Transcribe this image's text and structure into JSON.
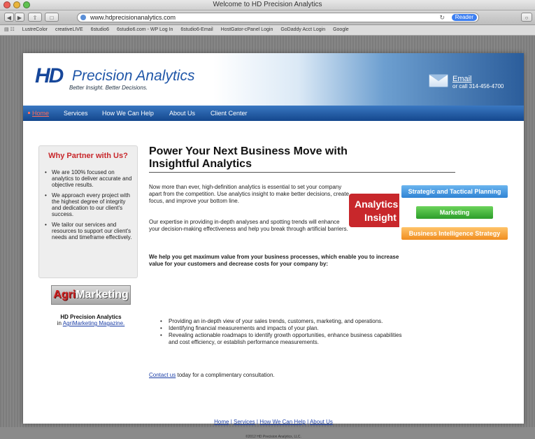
{
  "window": {
    "title": "Welcome to HD Precision Analytics"
  },
  "browser": {
    "url": "www.hdprecisionanalytics.com",
    "reader_label": "Reader",
    "bookmarks": [
      "LustreColor",
      "creativeLIVE",
      "6studio6",
      "6studio6.com - WP Log In",
      "6studio6-Email",
      "HostGator-cPanel Login",
      "GoDaddy Acct Login",
      "Google"
    ]
  },
  "header": {
    "logo_hd": "HD",
    "logo_name": "Precision Analytics",
    "tagline": "Better Insight. Better Decisions.",
    "email_label": "Email",
    "phone": "or call 314-456-4700"
  },
  "nav": {
    "items": [
      "Home",
      "Services",
      "How We Can Help",
      "About Us",
      "Client Center"
    ]
  },
  "sidebar": {
    "title": "Why Partner with Us?",
    "items": [
      "We are 100% focused on analytics to deliver accurate and objective results.",
      "We approach every project with the highest degree of integrity and dedication to our client's success.",
      "We tailor our services and resources to support our client's needs and timeframe effectively."
    ]
  },
  "agri": {
    "logo_a": "Agri",
    "logo_b": "Marketing",
    "caption_bold": "HD Precision Analytics",
    "caption_in": "in ",
    "caption_link": "AgriMarketing Magazine."
  },
  "main": {
    "heading": "Power Your Next Business Move with Insightful Analytics",
    "para1": "Now more than ever, high-definition analytics is essential to set your company apart from the competition. Use analytics insight to make better decisions, create focus, and improve your bottom line.",
    "para2": "Our expertise in providing in-depth analyses and spotting trends will enhance your decision-making effectiveness and help you break through artificial barriers.",
    "para3": "We help you get maximum value from your business processes, which enable you to increase value for your customers and decrease costs for your company by:",
    "bullets": [
      "Providing an in-depth view of your sales trends, customers, marketing, and operations.",
      "Identifying financial measurements and impacts of your plan.",
      "Revealing actionable roadmaps to identify growth opportunities, enhance business capabilities and cost efficiency, or establish performance measurements."
    ],
    "contact_link": "Contact us",
    "contact_rest": " today for a complimentary consultation."
  },
  "graphic": {
    "line1": "Analytics",
    "line2": "Insight",
    "tag_blue": "Strategic and Tactical Planning",
    "tag_green": "Marketing",
    "tag_orange": "Business Intelligence Strategy"
  },
  "footer": {
    "links": [
      "Home",
      "Services",
      "How We Can Help",
      "About Us"
    ],
    "separator": " | ",
    "copyright": "©2012 HD Precision Analytics, LLC."
  },
  "colors": {
    "brand_blue": "#17479a",
    "accent_red": "#c8272b"
  }
}
